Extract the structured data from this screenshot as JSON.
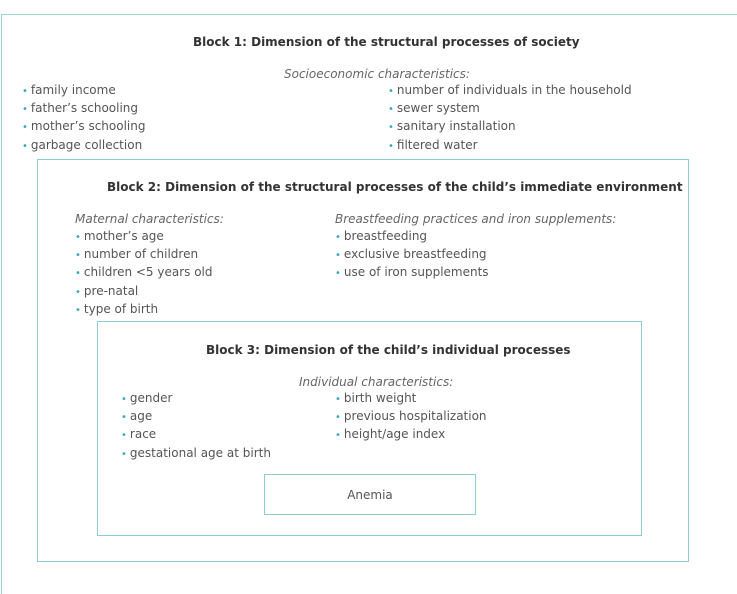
{
  "accent_color": "#3aa8b8",
  "border_color": "#9fd3db",
  "block1": {
    "title": "Block 1: Dimension of the structural processes of society",
    "subtitle": "Socioeconomic characteristics:",
    "left_items": [
      "family income",
      "father’s schooling",
      "mother’s schooling",
      "garbage collection"
    ],
    "right_items": [
      "number of individuals in the household",
      "sewer system",
      "sanitary installation",
      "filtered water"
    ]
  },
  "block2": {
    "title": "Block 2: Dimension of the structural processes of the child’s immediate environment",
    "left_subtitle": "Maternal characteristics:",
    "left_items": [
      "mother’s age",
      "number of children",
      "children  <5 years old",
      "pre-natal",
      "type of birth"
    ],
    "right_subtitle": "Breastfeeding practices and iron supplements:",
    "right_items": [
      "breastfeeding",
      "exclusive breastfeeding",
      "use of iron supplements"
    ]
  },
  "block3": {
    "title": "Block 3: Dimension of the child’s individual processes",
    "subtitle": "Individual characteristics:",
    "left_items": [
      "gender",
      "age",
      "race",
      "gestational age at birth"
    ],
    "right_items": [
      "birth weight",
      "previous hospitalization",
      "height/age index"
    ]
  },
  "outcome": {
    "label": "Anemia"
  }
}
